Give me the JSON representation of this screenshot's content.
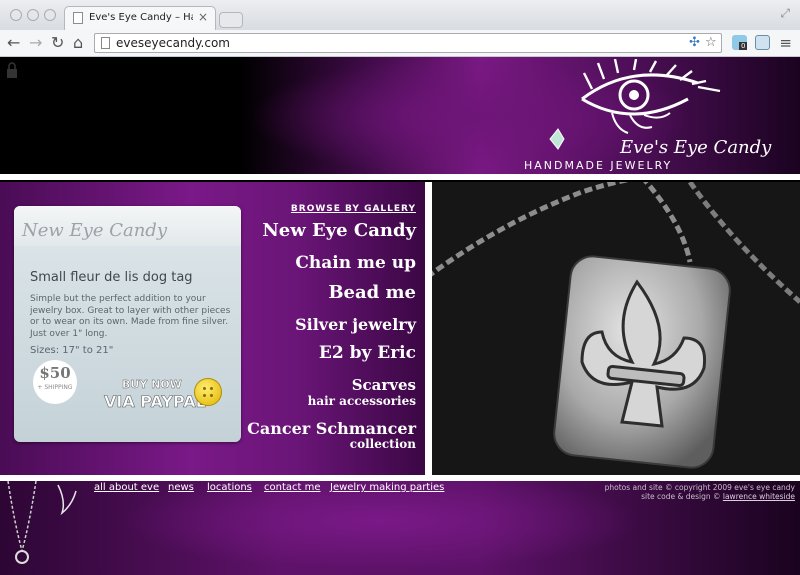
{
  "browser": {
    "tab_title": "Eve's Eye Candy – Handma",
    "tab_close": "×",
    "url": "eveseyecandy.com",
    "extension_badge": "0"
  },
  "header": {
    "logo_name": "Eve's Eye Candy",
    "logo_tagline": "HANDMADE JEWELRY"
  },
  "product_card": {
    "title": "New Eye Candy",
    "name": "Small fleur de lis dog tag",
    "description": "Simple but the perfect addition to your jewelry box. Great to layer with other pieces or to wear on its own. Made from fine silver. Just over 1\" long.",
    "sizes": "Sizes: 17\" to 21\"",
    "price": "$50",
    "shipping": "+ SHIPPING",
    "buy_line1": "BUY NOW",
    "buy_line2": "VIA PAYPAL"
  },
  "gallery": {
    "label": "BROWSE BY GALLERY",
    "items": [
      "New Eye Candy",
      "Chain me up",
      "Bead me",
      "Silver jewelry",
      "E2 by Eric",
      "Scarves",
      "hair accessories",
      "Cancer Schmancer",
      "collection"
    ]
  },
  "footer": {
    "links": [
      "all about eve",
      "news",
      "locations",
      "contact me",
      "Jewelry making parties"
    ],
    "copyright_line1": "photos and site © copyright 2009 eve's eye candy",
    "copyright_line2_prefix": "site code & design © ",
    "copyright_designer": "lawrence whiteside"
  },
  "colors": {
    "brand_purple": "#7a1988",
    "card_bg": "#c4d2d8",
    "paypal_button": "#f2cc1c"
  }
}
